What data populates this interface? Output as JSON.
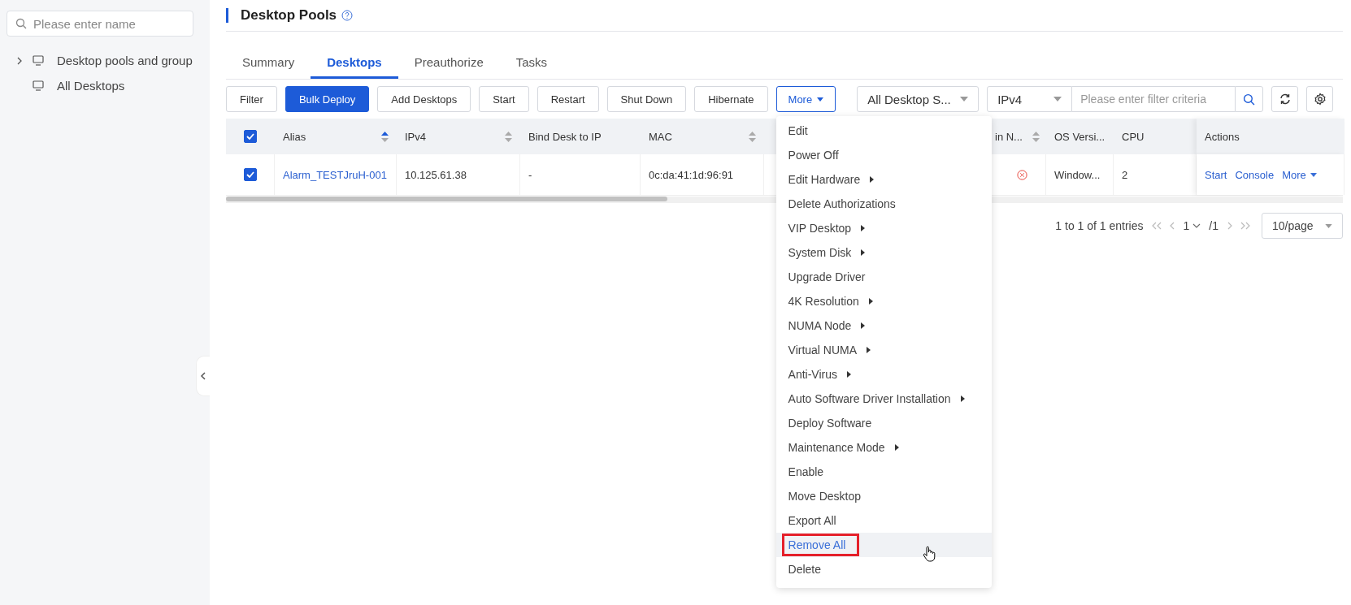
{
  "sidebar": {
    "search": {
      "placeholder": "Please enter name"
    },
    "tree": [
      {
        "label": "Desktop pools and group",
        "kind": "group",
        "expanded": false
      },
      {
        "label": "All Desktops",
        "kind": "leaf"
      }
    ]
  },
  "page": {
    "title": "Desktop Pools"
  },
  "tabs": [
    {
      "label": "Summary",
      "selected": false
    },
    {
      "label": "Desktops",
      "selected": true
    },
    {
      "label": "Preauthorize",
      "selected": false
    },
    {
      "label": "Tasks",
      "selected": false
    }
  ],
  "toolbar": {
    "buttons": [
      {
        "label": "Filter",
        "kind": "default"
      },
      {
        "label": "Bulk Deploy",
        "kind": "primary"
      },
      {
        "label": "Add Desktops",
        "kind": "default"
      },
      {
        "label": "Start",
        "kind": "default"
      },
      {
        "label": "Restart",
        "kind": "default"
      },
      {
        "label": "Shut Down",
        "kind": "default"
      },
      {
        "label": "Hibernate",
        "kind": "default"
      },
      {
        "label": "More",
        "kind": "dropdown"
      }
    ],
    "status_select": "All Desktop S...",
    "ip_select": "IPv4",
    "filter": {
      "placeholder": "Please enter filter criteria"
    }
  },
  "table": {
    "header_checked": true,
    "columns": [
      {
        "label": "Alias",
        "kind": "sortable",
        "sort_active": true
      },
      {
        "label": "IPv4",
        "kind": "sortable",
        "sort_active": false
      },
      {
        "label": "Bind Desk to IP",
        "kind": "plain"
      },
      {
        "label": "MAC",
        "kind": "sortable",
        "sort_active": false
      },
      {
        "label": "in N...",
        "kind": "sortable",
        "sort_active": false
      },
      {
        "label": "OS Versi...",
        "kind": "plain"
      },
      {
        "label": "CPU",
        "kind": "plain"
      },
      {
        "label": "Actions",
        "kind": "plain"
      }
    ],
    "rows": [
      {
        "checked": true,
        "cells": [
          {
            "kind": "link",
            "text": "Alarm_TESTJruH-001"
          },
          {
            "kind": "text",
            "text": "10.125.61.38"
          },
          {
            "kind": "text",
            "text": "-"
          },
          {
            "kind": "text",
            "text": "0c:da:41:1d:96:91"
          },
          {
            "kind": "error"
          },
          {
            "kind": "text",
            "text": "Window..."
          },
          {
            "kind": "text",
            "text": "2"
          },
          {
            "kind": "actions",
            "links": [
              "Start",
              "Console",
              "More"
            ]
          }
        ]
      }
    ]
  },
  "pagination": {
    "summary": "1 to 1 of 1 entries",
    "page": "1",
    "total": "/1",
    "page_size": "10/page"
  },
  "menu": {
    "items": [
      {
        "label": "Edit",
        "submenu": false,
        "highlighted": false
      },
      {
        "label": "Power Off",
        "submenu": false,
        "highlighted": false
      },
      {
        "label": "Edit Hardware",
        "submenu": true,
        "highlighted": false
      },
      {
        "label": "Delete Authorizations",
        "submenu": false,
        "highlighted": false
      },
      {
        "label": "VIP Desktop",
        "submenu": true,
        "highlighted": false
      },
      {
        "label": "System Disk",
        "submenu": true,
        "highlighted": false
      },
      {
        "label": "Upgrade Driver",
        "submenu": false,
        "highlighted": false
      },
      {
        "label": "4K Resolution",
        "submenu": true,
        "highlighted": false
      },
      {
        "label": "NUMA Node",
        "submenu": true,
        "highlighted": false
      },
      {
        "label": "Virtual NUMA",
        "submenu": true,
        "highlighted": false
      },
      {
        "label": "Anti-Virus",
        "submenu": true,
        "highlighted": false
      },
      {
        "label": "Auto Software Driver Installation",
        "submenu": true,
        "highlighted": false
      },
      {
        "label": "Deploy Software",
        "submenu": false,
        "highlighted": false
      },
      {
        "label": "Maintenance Mode",
        "submenu": true,
        "highlighted": false
      },
      {
        "label": "Enable",
        "submenu": false,
        "highlighted": false
      },
      {
        "label": "Move Desktop",
        "submenu": false,
        "highlighted": false
      },
      {
        "label": "Export All",
        "submenu": false,
        "highlighted": false
      },
      {
        "label": "Remove All",
        "submenu": false,
        "highlighted": true
      },
      {
        "label": "Delete",
        "submenu": false,
        "highlighted": false
      }
    ]
  }
}
